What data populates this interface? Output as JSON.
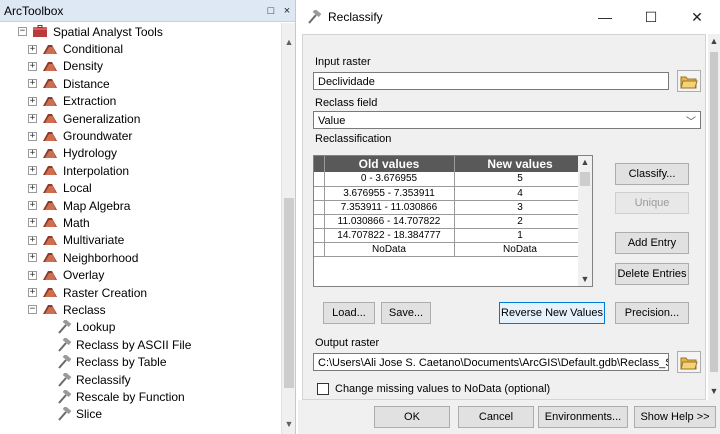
{
  "toolbox": {
    "title": "ArcToolbox",
    "pin_glyph": "□",
    "close_glyph": "×",
    "root": "Spatial Analyst Tools",
    "toolsets": [
      "Conditional",
      "Density",
      "Distance",
      "Extraction",
      "Generalization",
      "Groundwater",
      "Hydrology",
      "Interpolation",
      "Local",
      "Map Algebra",
      "Math",
      "Multivariate",
      "Neighborhood",
      "Overlay",
      "Raster Creation",
      "Reclass"
    ],
    "reclass_tools": [
      "Lookup",
      "Reclass by ASCII File",
      "Reclass by Table",
      "Reclassify",
      "Rescale by Function",
      "Slice"
    ],
    "expand_glyph": "+",
    "collapse_glyph": "−",
    "scroll_up": "▲",
    "scroll_down": "▼"
  },
  "dialog": {
    "title": "Reclassify",
    "minimize": "—",
    "maximize": "☐",
    "close": "✕",
    "input_raster_label": "Input raster",
    "input_raster_value": "Declividade",
    "reclass_field_label": "Reclass field",
    "reclass_field_value": "Value",
    "reclassification_label": "Reclassification",
    "table": {
      "headers": [
        "Old values",
        "New values"
      ],
      "rows": [
        [
          "0 - 3.676955",
          "5"
        ],
        [
          "3.676955 - 7.353911",
          "4"
        ],
        [
          "7.353911 - 11.030866",
          "3"
        ],
        [
          "11.030866 - 14.707822",
          "2"
        ],
        [
          "14.707822 - 18.384777",
          "1"
        ],
        [
          "NoData",
          "NoData"
        ]
      ]
    },
    "buttons": {
      "classify": "Classify...",
      "unique": "Unique",
      "add_entry": "Add Entry",
      "delete_entries": "Delete Entries",
      "load": "Load...",
      "save": "Save...",
      "reverse": "Reverse New Values",
      "precision": "Precision..."
    },
    "output_raster_label": "Output raster",
    "output_raster_value": "C:\\Users\\Ali Jose S. Caetano\\Documents\\ArcGIS\\Default.gdb\\Reclass_Slo",
    "nodata_checkbox_label": "Change missing values to NoData (optional)",
    "footer": {
      "ok": "OK",
      "cancel": "Cancel",
      "environments": "Environments...",
      "show_help": "Show Help >>"
    },
    "dropdown_arrow": "﹀"
  }
}
